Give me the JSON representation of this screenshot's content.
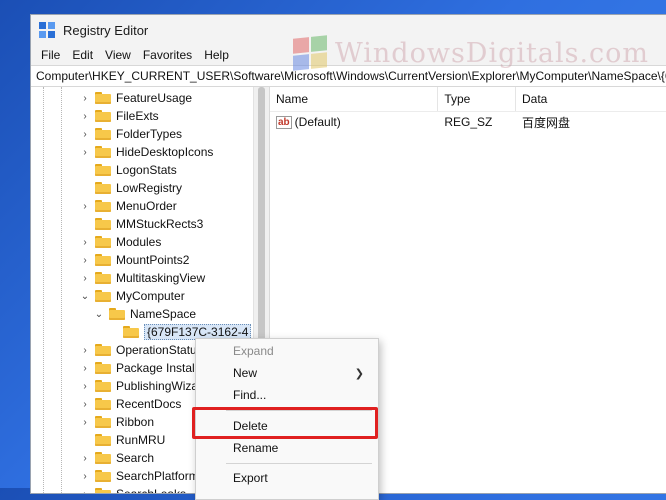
{
  "window": {
    "title": "Registry Editor"
  },
  "watermark": {
    "text": "WindowsDigitals.com"
  },
  "menu": [
    "File",
    "Edit",
    "View",
    "Favorites",
    "Help"
  ],
  "address": "Computer\\HKEY_CURRENT_USER\\Software\\Microsoft\\Windows\\CurrentVersion\\Explorer\\MyComputer\\NameSpace\\{67",
  "tree": [
    {
      "label": "FeatureUsage"
    },
    {
      "label": "FileExts"
    },
    {
      "label": "FolderTypes"
    },
    {
      "label": "HideDesktopIcons"
    },
    {
      "label": "LogonStats"
    },
    {
      "label": "LowRegistry"
    },
    {
      "label": "MenuOrder"
    },
    {
      "label": "MMStuckRects3"
    },
    {
      "label": "Modules"
    },
    {
      "label": "MountPoints2"
    },
    {
      "label": "MultitaskingView"
    },
    {
      "label": "MyComputer"
    },
    {
      "label": "NameSpace"
    },
    {
      "label": "{679F137C-3162-4"
    },
    {
      "label": "OperationStatus"
    },
    {
      "label": "Package Installa"
    },
    {
      "label": "PublishingWiza"
    },
    {
      "label": "RecentDocs"
    },
    {
      "label": "Ribbon"
    },
    {
      "label": "RunMRU"
    },
    {
      "label": "Search"
    },
    {
      "label": "SearchPlatform"
    },
    {
      "label": "SearchLeaks"
    }
  ],
  "columns": [
    "Name",
    "Type",
    "Data"
  ],
  "values": [
    {
      "name": "(Default)",
      "type": "REG_SZ",
      "data": "百度网盘",
      "icon_text": "ab"
    }
  ],
  "context_menu": {
    "expand": "Expand",
    "new": "New",
    "find": "Find...",
    "delete": "Delete",
    "rename": "Rename",
    "export": "Export"
  },
  "colors": {
    "highlight": "#e02020",
    "selection": "#d8e6f7",
    "folder": "#f7c84a"
  }
}
